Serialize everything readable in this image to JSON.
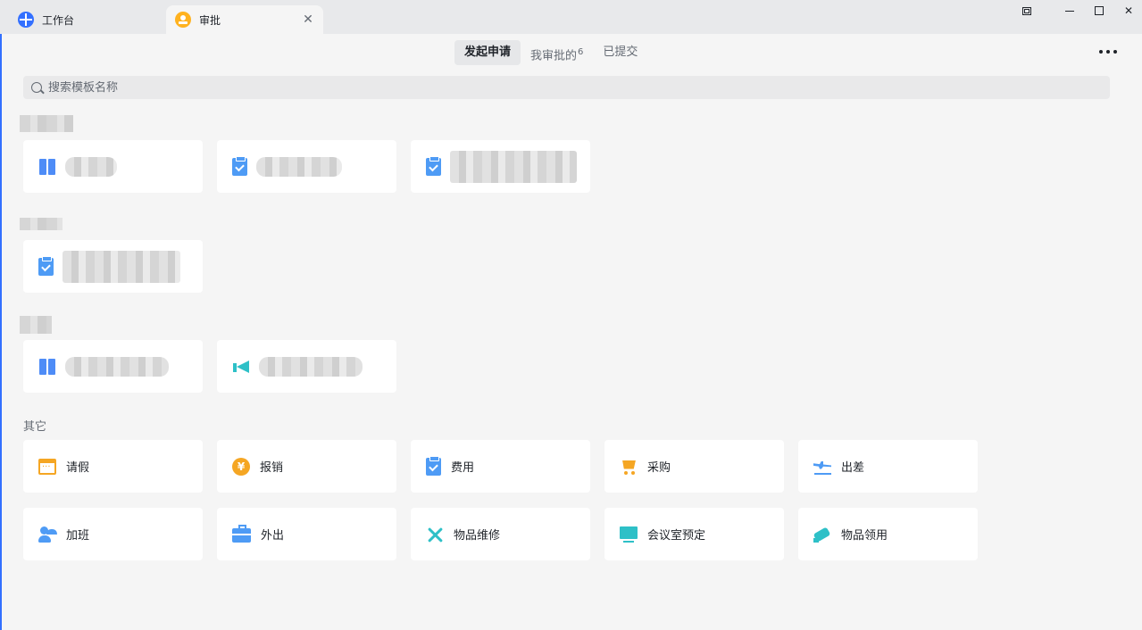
{
  "tabs": [
    {
      "label": "工作台",
      "icon": "workbench-icon"
    },
    {
      "label": "审批",
      "icon": "approval-icon",
      "active": true
    }
  ],
  "header": {
    "segments": [
      {
        "label": "发起申请",
        "active": true
      },
      {
        "label": "我审批的",
        "badge": "6"
      },
      {
        "label": "已提交"
      }
    ]
  },
  "search": {
    "placeholder": "搜索模板名称"
  },
  "sections": {
    "other": {
      "title": "其它",
      "items": [
        {
          "label": "请假",
          "icon": "calendar-icon"
        },
        {
          "label": "报销",
          "icon": "coin-icon",
          "glyph": "¥"
        },
        {
          "label": "费用",
          "icon": "clipboard-check-icon"
        },
        {
          "label": "采购",
          "icon": "cart-icon"
        },
        {
          "label": "出差",
          "icon": "airplane-icon"
        },
        {
          "label": "加班",
          "icon": "person-clock-icon"
        },
        {
          "label": "外出",
          "icon": "briefcase-icon"
        },
        {
          "label": "物品维修",
          "icon": "tools-icon"
        },
        {
          "label": "会议室预定",
          "icon": "presentation-screen-icon"
        },
        {
          "label": "物品领用",
          "icon": "hand-receive-icon"
        }
      ]
    }
  },
  "colors": {
    "accent_blue": "#4e9bf5",
    "accent_orange": "#f5a623",
    "accent_teal": "#2ec0c7"
  }
}
